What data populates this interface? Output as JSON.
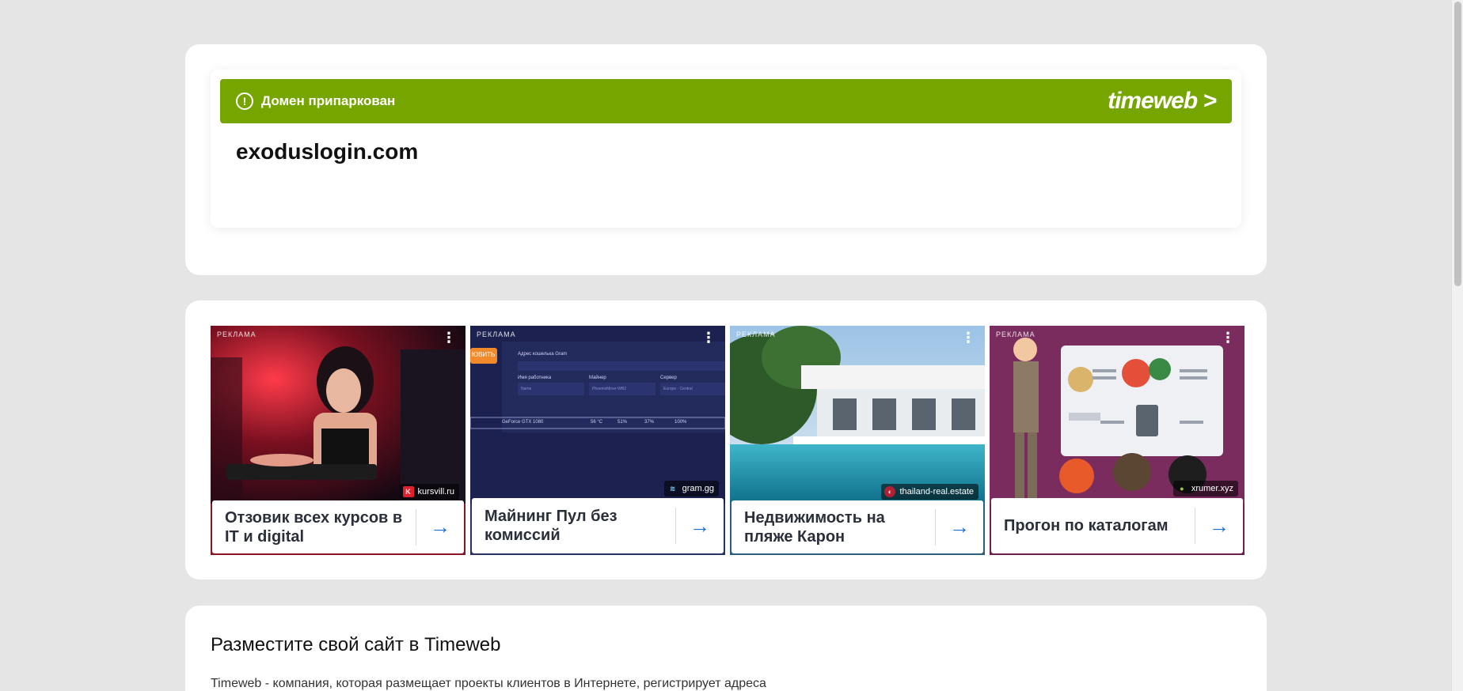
{
  "parked": {
    "banner_text": "Домен припаркован",
    "brand": "timeweb >",
    "domain": "exoduslogin.com"
  },
  "ads": [
    {
      "tag": "РЕКЛАМА",
      "source": "kursvill.ru",
      "source_icon": "K",
      "title": "Отзовик всех курсов в IT и digital"
    },
    {
      "tag": "РЕКЛАМА",
      "source": "gram.gg",
      "source_icon": "≋",
      "title": "Майнинг Пул без комиссий"
    },
    {
      "tag": "РЕКЛАМА",
      "source": "thailand-real.estate",
      "source_icon": "◐",
      "title": "Недвижимость на пляже Карон"
    },
    {
      "tag": "РЕКЛАМА",
      "source": "xrumer.xyz",
      "source_icon": "•",
      "title": "Прогон по каталогам"
    }
  ],
  "mining_ui": {
    "button": "ЮВИТЬ",
    "wallet_label": "Адрес кошелька Gram",
    "worker_label": "Имя работника",
    "miner_label": "Майнер",
    "server_label": "Сервер",
    "worker_value": "Name",
    "miner_value": "PhoenixMiner-WB2",
    "server_value": "Europe - Central",
    "gpu_row": "GeForce GTX 1080",
    "temp": "56 °C",
    "fan": "51%",
    "load": "37%",
    "power": "100%"
  },
  "info": {
    "title": "Разместите свой сайт в Timeweb",
    "text": "Timeweb - компания, которая размещает проекты клиентов в Интернете, регистрирует адреса"
  },
  "colors": {
    "banner": "#76a500",
    "page_bg": "#e5e5e5",
    "arrow": "#1a6fd8"
  }
}
